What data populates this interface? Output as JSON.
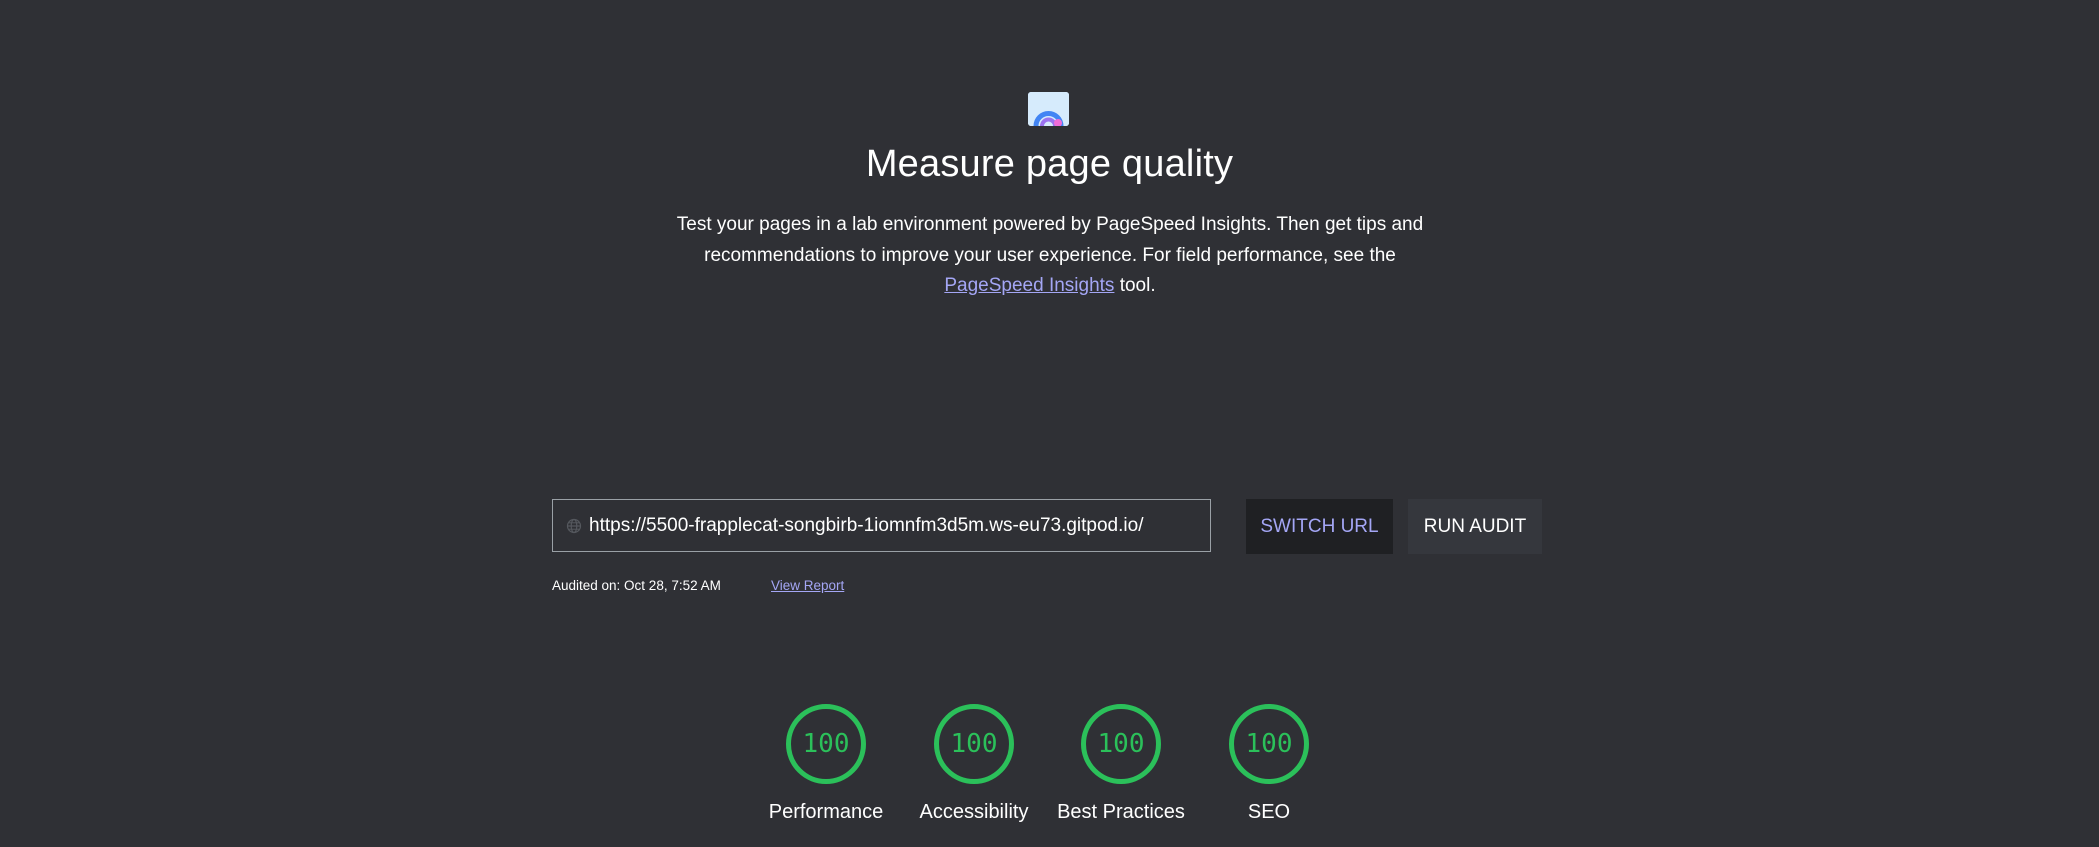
{
  "hero": {
    "icon": "lighthouse-gauge-icon",
    "title": "Measure page quality",
    "desc_part1": "Test your pages in a lab environment powered by PageSpeed Insights. Then get tips and recommendations to improve your user experience. For field performance, see the ",
    "link_text": "PageSpeed Insights",
    "desc_part2": " tool."
  },
  "audit": {
    "url_value": "https://5500-frapplecat-songbirb-1iomnfm3d5m.ws-eu73.gitpod.io/",
    "url_icon": "globe-icon",
    "switch_label": "SWITCH URL",
    "run_label": "RUN AUDIT",
    "audited_text": "Audited on: Oct 28, 7:52 AM",
    "view_report_label": "View Report"
  },
  "scores": [
    {
      "label": "Performance",
      "value": "100"
    },
    {
      "label": "Accessibility",
      "value": "100"
    },
    {
      "label": "Best Practices",
      "value": "100"
    },
    {
      "label": "SEO",
      "value": "100"
    }
  ],
  "colors": {
    "background": "#2f3035",
    "accent": "#a4a6f5",
    "score_good": "#2bc05a"
  }
}
